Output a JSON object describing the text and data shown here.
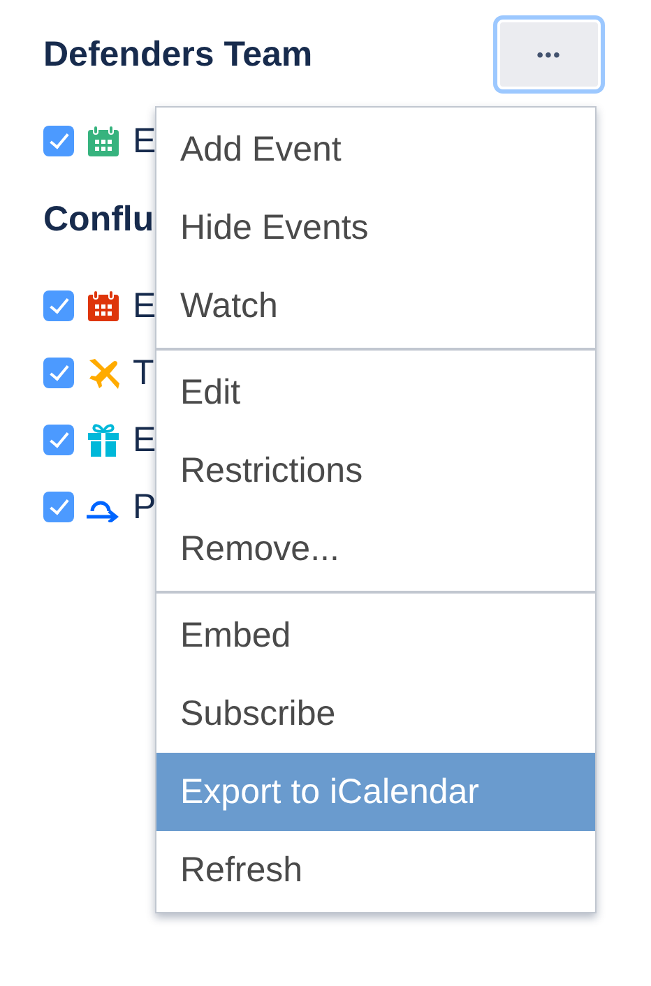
{
  "groups": [
    {
      "title": "Defenders Team",
      "menu_button": "•••",
      "calendars": [
        {
          "kind": "event",
          "color": "#36b37e",
          "checked": true,
          "label": "E"
        }
      ]
    },
    {
      "title": "Conflu",
      "calendars": [
        {
          "kind": "event",
          "color": "#de350b",
          "checked": true,
          "label": "E"
        },
        {
          "kind": "travel",
          "color": "#ffab00",
          "checked": true,
          "label": "T"
        },
        {
          "kind": "gift",
          "color": "#00b8d9",
          "checked": true,
          "label": "E"
        },
        {
          "kind": "repeat",
          "color": "#0065ff",
          "checked": true,
          "label": "P"
        }
      ]
    }
  ],
  "menu": {
    "sections": [
      [
        {
          "label": "Add Event",
          "selected": false
        },
        {
          "label": "Hide Events",
          "selected": false
        },
        {
          "label": "Watch",
          "selected": false
        }
      ],
      [
        {
          "label": "Edit",
          "selected": false
        },
        {
          "label": "Restrictions",
          "selected": false
        },
        {
          "label": "Remove...",
          "selected": false
        }
      ],
      [
        {
          "label": "Embed",
          "selected": false
        },
        {
          "label": "Subscribe",
          "selected": false
        },
        {
          "label": "Export to iCalendar",
          "selected": true
        },
        {
          "label": "Refresh",
          "selected": false
        }
      ]
    ]
  }
}
